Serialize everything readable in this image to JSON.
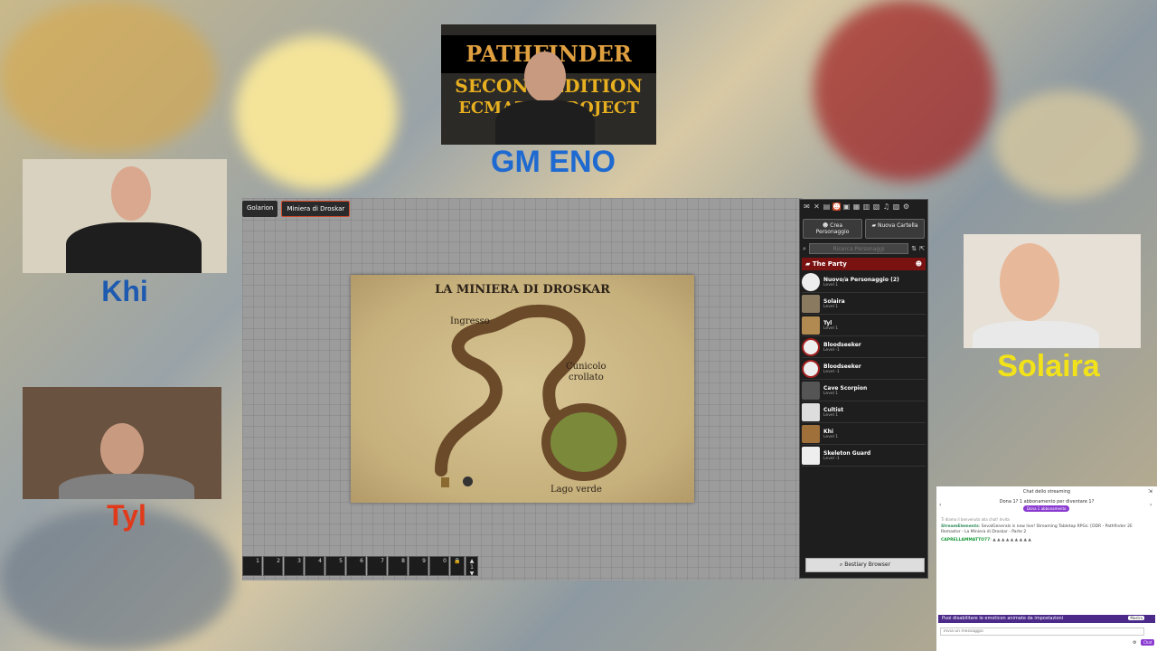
{
  "cams": {
    "gm": {
      "logo_line1": "PATHFINDER",
      "logo_line2": "SECOND EDITION",
      "logo_line3": "ECMAZIO PROJECT",
      "label": "GM ENO"
    },
    "khi": {
      "label": "Khi"
    },
    "tyl": {
      "label": "Tyl"
    },
    "solaira": {
      "label": "Solaira"
    }
  },
  "scene_tabs": [
    {
      "label": "Golarion"
    },
    {
      "label": "Miniera di Droskar"
    }
  ],
  "map": {
    "title": "LA MINIERA DI DROSKAR",
    "labels": {
      "ingresso": "Ingresso",
      "cunicolo1": "Cunicolo",
      "cunicolo2": "crollato",
      "lago": "Lago verde"
    }
  },
  "hotbar": {
    "slots": [
      "1",
      "2",
      "3",
      "4",
      "5",
      "6",
      "7",
      "8",
      "9",
      "0"
    ],
    "page": "1"
  },
  "sidebar": {
    "create_actor": "Crea Personaggio",
    "new_folder": "Nuova Cartella",
    "search_placeholder": "Ricerca Personaggi",
    "folder": "The Party",
    "actors": [
      {
        "name": "Nuovo/a Personaggio (2)",
        "level": "Level 1"
      },
      {
        "name": "Solaira",
        "level": "Level 1"
      },
      {
        "name": "Tyl",
        "level": "Level 1"
      },
      {
        "name": "Bloodseeker",
        "level": "Level -1"
      },
      {
        "name": "Bloodseeker",
        "level": "Level -1"
      },
      {
        "name": "Cave Scorpion",
        "level": "Level 1"
      },
      {
        "name": "Cultist",
        "level": "Level 1"
      },
      {
        "name": "Khi",
        "level": "Level 1"
      },
      {
        "name": "Skeleton Guard",
        "level": "Level -1"
      }
    ],
    "bestiary": "Bestiary Browser"
  },
  "chat": {
    "header": "Chat dello streaming",
    "promo": "Dona 1? 1 abbonamento per diventare 1?",
    "promo_btn": "Dona 1 abbonamento",
    "line_system": "Ti diamo il benvenuto alla chat! Invita",
    "msg1_user": "StreamElements",
    "msg1_text": "SevalGenerals is now live! Streaming Tabletop RPGs: [ODR - Pathfinder 2E Remaster - La Miniera di Droskar - Parte 2",
    "msg2_user": "CAPRELLAMMATTO77",
    "banner": "Puoi disabilitare le emoticon animate da impostazioni",
    "banner_btn": "Mostra",
    "input_placeholder": "Invia un messaggio",
    "chat_btn": "Chat"
  }
}
